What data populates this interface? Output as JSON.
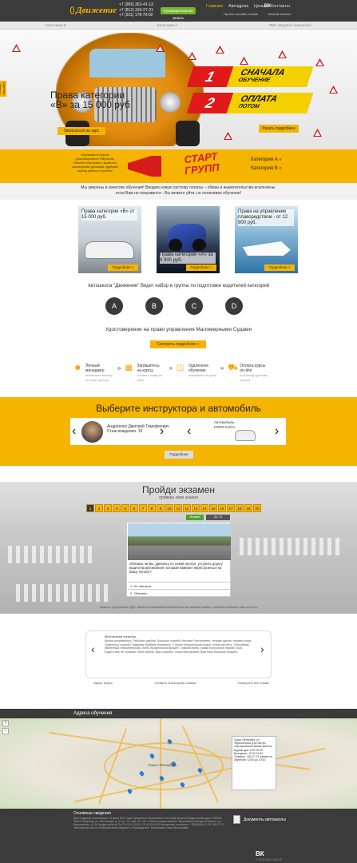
{
  "header": {
    "logo_text": "Движение",
    "phones": [
      "+7 (965) 362-41-13",
      "+7 (812) 334-27-21",
      "+7 (911) 178-70-02"
    ],
    "cta_label": "Предварительная запись",
    "nav": [
      "Главная",
      "Автодром",
      "Цены",
      "Контакты"
    ],
    "vk_label": "ВК",
    "sub_links": [
      "Пройти онлайн-онлайн",
      "Личный кабинет"
    ]
  },
  "tabs": [
    "Категория B",
    "Категория A",
    "ПМС (Водный транспорт)"
  ],
  "hero": {
    "title_line1": "Права категории",
    "title_line2": "«B» за 15 000 руб",
    "enroll_label": "Записаться на курс",
    "stripe1_num": "1",
    "stripe1_big": "СНАЧАЛА",
    "stripe1_small": "ОБУЧЕНИЕ",
    "stripe2_num": "2",
    "stripe2_big": "ОПЛАТА",
    "stripe2_small": "ПОТОМ",
    "learn_more_label": "Узнать подробнее",
    "side_badge": "Сделать звонок"
  },
  "start": {
    "left_text": "Обучение в классе Дистанционное Обучение Начало Обучения с момента заключения договора Удобный выбор работы и учёбы!",
    "title_line1": "СТАРТ",
    "title_line2": "ГРУПП",
    "cat_a": "Категория А",
    "cat_b": "Категория В",
    "arrow": "»"
  },
  "trust": {
    "line1": "Мы уверены в качестве обучения! Вводим новую систему оплаты – обман и вымогательства исключены:",
    "line2": "если Вам не понравится - Вы можете уйти, не оплачивая обучение!"
  },
  "cards": [
    {
      "title": "Права категории «B» от 15 000 руб.",
      "more": "Подробнее »"
    },
    {
      "title": "Права категории «A» за 9 900 руб.",
      "more": "Подробнее »"
    },
    {
      "title": "Права на управление плавсредством - от 12 900 руб.",
      "more": "Подробнее »"
    }
  ],
  "school": {
    "text": "Автошкола \"Движение\" Ведет набор в группы по подготовке водителей категорий",
    "categories": [
      "A",
      "B",
      "C",
      "D"
    ],
    "water_text": "Удостоверение на право управления Маломерными Судами",
    "more_label": "Смотреть подробнее »"
  },
  "steps": [
    {
      "icon": "person-icon",
      "title": "Личный менеджер",
      "desc": "назначается вашему личному куратору"
    },
    {
      "icon": "calendar-icon",
      "title": "Запишитесь на курсы",
      "desc": "Оставьте заявку на сайте"
    },
    {
      "icon": "monitor-icon",
      "title": "Удаленное обучение",
      "desc": "занимайтесь из дома"
    },
    {
      "icon": "car-icon",
      "title": "Оплата курсы on-line",
      "desc": "по Вашему удобному способу"
    }
  ],
  "instructor": {
    "title": "Выберите инструктора и автомобиль",
    "name": "Андреенко Дмитрий Тимофеевич",
    "experience": "Стаж вождения: 15",
    "car_label": "Автомобиль",
    "car_name": "FORD KUGA",
    "details_label": "Подробнее"
  },
  "exam": {
    "title": "Пройди экзамен",
    "subtitle": "проверь свои знания",
    "numbers": [
      "1",
      "2",
      "3",
      "4",
      "5",
      "6",
      "7",
      "8",
      "9",
      "10",
      "11",
      "12",
      "13",
      "14",
      "15",
      "16",
      "17",
      "18",
      "19",
      "20"
    ],
    "correct_label": "Экзамен",
    "time_label": "25 : 07",
    "question": "Обязаны ли Вы, двигаясь по левой полосе, уступить дорогу водителю автомобиля, который намерен перестроиться на Вашу полосу?",
    "answers": [
      "1. Не обязаны.",
      "2. Обязаны."
    ],
    "notice": "Модель «Дорожный ПДД» является ознакомительной! Если Вы вышли ошибку, просьба сообщить нам на почту"
  },
  "review": {
    "name": "Мохнаткина Наталья",
    "text": "Школа понравилась. Работает удобно. Большое спасибо Наталье Григорьевне, теорию сдала с первого раза. Отдельное спасибо Гаджиеву Курбану Игоревичу. С таким инструктором можно только мечтать. Спокойный, уверенный, внимательный, очень профессиональный!!! Спасибо всем. Права получила в ноябре 2018. Ездить мне не страшно. Всех люблю. Ваш спасибо, Ольга Викторовна. Вам тоже большое спасибо.",
    "add_label": "Задать вопрос",
    "all_reviews": "Оставить отзыв Архив отзывов",
    "ask": "Посмотреть все отзывы"
  },
  "map": {
    "title": "Адреса обучения",
    "city": "Санкт-Петербург",
    "address_box": "Санкт-Петербург, ул. Фурштатская д.3А Метро: Чернышевская Время работы: Будние дни: 9:00-20:00, Выходные: 10:00-16:00 Телефон: 334-27-21 Заявки на обучение: 12:00 до 20:00",
    "zoom_in": "+",
    "zoom_out": "−"
  },
  "footer": {
    "title": "Основные сведения",
    "text": "Дата создания организации: 25 июня 2017 года Учредитель: Мохнаткина Ольга Викторовна Юридический адрес: 195043, Санкт-Петербург, ул. Лахтинская, д. 4, стр. 1А, пом. 1Н, лит. А Место осуществления образовательной деятельности: ул. Фурштатская, д. 3А График работы: Пн-Пт 10.00-20.00, Сб 10.00-16.00 Контактные телефоны: +7(965)362-41-13, 334-27-21 Электронная почта: info@avtoshkola-dvigenie.ru Руководитель: Мохнаткина Ольга Викторовна",
    "docs_label": "Документы автошколы",
    "vk": "ВК",
    "copy": "© 2012-2022 ЭКСПЛ"
  },
  "colors": {
    "accent": "#f5b400",
    "dark": "#3b3b3b",
    "red": "#e01a1a",
    "green": "#77b52b"
  }
}
